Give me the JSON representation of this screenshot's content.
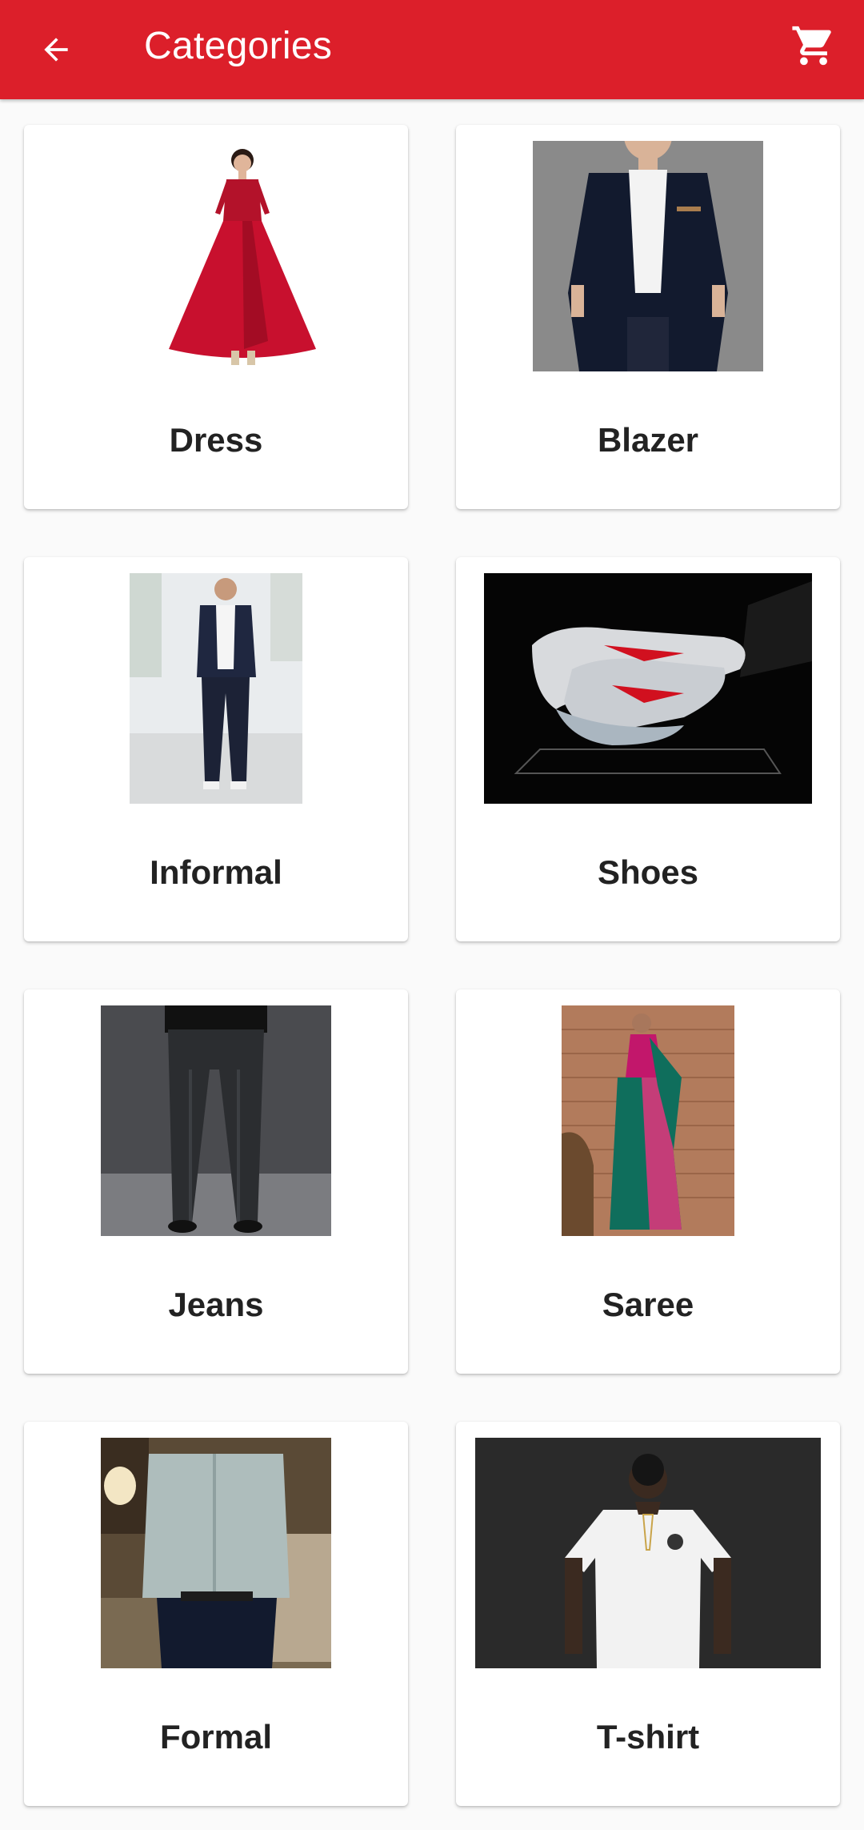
{
  "appbar": {
    "title": "Categories",
    "back_icon": "arrow-back-icon",
    "cart_icon": "shopping-cart-icon",
    "color": "#dc1f2a"
  },
  "categories": [
    {
      "name": "Dress"
    },
    {
      "name": "Blazer"
    },
    {
      "name": "Informal"
    },
    {
      "name": "Shoes"
    },
    {
      "name": "Jeans"
    },
    {
      "name": "Saree"
    },
    {
      "name": "Formal"
    },
    {
      "name": "T-shirt"
    }
  ]
}
